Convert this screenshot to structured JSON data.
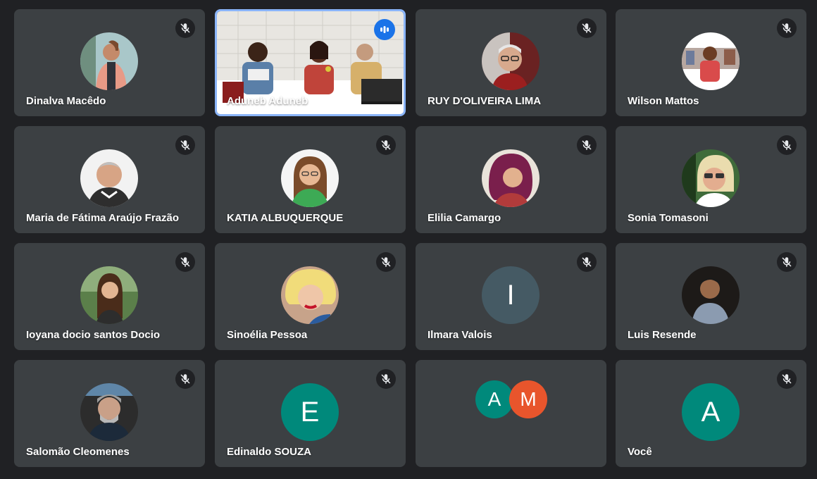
{
  "colors": {
    "background": "#202124",
    "tile": "#3c4043",
    "speaking_border": "#8ab4f8",
    "speaking_badge": "#1a73e8",
    "teal_avatar": "#00897b",
    "slate_avatar": "#455a64",
    "orange_avatar": "#e8552c"
  },
  "participants": [
    {
      "name": "Dinalva Macêdo",
      "muted": true,
      "avatar": "photo"
    },
    {
      "name": "Aduneb Aduneb",
      "muted": false,
      "speaking": true,
      "avatar": "video"
    },
    {
      "name": "RUY D'OLIVEIRA LIMA",
      "muted": true,
      "avatar": "photo"
    },
    {
      "name": "Wilson Mattos",
      "muted": true,
      "avatar": "photo"
    },
    {
      "name": "Maria de Fátima Araújo Frazão",
      "muted": true,
      "avatar": "photo"
    },
    {
      "name": "KATIA ALBUQUERQUE",
      "muted": true,
      "avatar": "photo"
    },
    {
      "name": "Elilia Camargo",
      "muted": true,
      "avatar": "photo"
    },
    {
      "name": "Sonia Tomasoni",
      "muted": true,
      "avatar": "photo"
    },
    {
      "name": "Ioyana docio santos Docio",
      "muted": true,
      "avatar": "photo"
    },
    {
      "name": "Sinoélia Pessoa",
      "muted": true,
      "avatar": "photo"
    },
    {
      "name": "Ilmara Valois",
      "muted": true,
      "avatar": "letter",
      "initial": "I"
    },
    {
      "name": "Luis Resende",
      "muted": true,
      "avatar": "photo"
    },
    {
      "name": "Salomão Cleomenes",
      "muted": true,
      "avatar": "photo"
    },
    {
      "name": "Edinaldo SOUZA",
      "muted": true,
      "avatar": "letter",
      "initial": "E"
    },
    {
      "name": "",
      "muted": false,
      "avatar": "group",
      "initials": [
        "A",
        "M"
      ]
    },
    {
      "name": "Você",
      "muted": true,
      "avatar": "letter",
      "initial": "A"
    }
  ]
}
